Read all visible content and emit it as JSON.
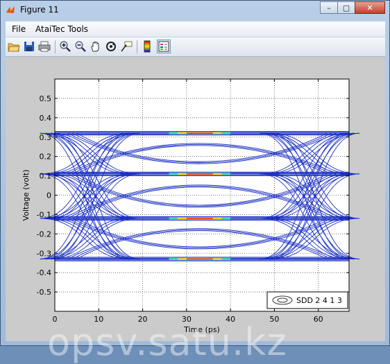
{
  "window": {
    "title": "Figure 11",
    "buttons": [
      "–",
      "▢",
      "✕"
    ]
  },
  "menu": {
    "items": [
      "File",
      "AtaiTec Tools"
    ]
  },
  "toolbar": {
    "icons": [
      "open-folder-icon",
      "save-icon",
      "print-icon",
      "zoom-in-icon",
      "zoom-out-icon",
      "pan-hand-icon",
      "rotate-3d-icon",
      "data-cursor-icon",
      "colorbar-icon",
      "legend-icon"
    ]
  },
  "chart_data": {
    "type": "contour",
    "title": "",
    "xlabel": "Time (ps)",
    "ylabel": "Voltage (volt)",
    "xlim": [
      0,
      67
    ],
    "ylim": [
      -0.6,
      0.6
    ],
    "xticks": [
      0,
      10,
      20,
      30,
      40,
      50,
      60
    ],
    "yticks": [
      -0.5,
      -0.4,
      -0.3,
      -0.2,
      -0.1,
      0,
      0.1,
      0.2,
      0.3,
      0.4,
      0.5
    ],
    "grid": true,
    "legend": {
      "entries": [
        "SDD 2 4 1 3"
      ],
      "placement": "bottom-right"
    },
    "levels": [
      -0.33,
      -0.12,
      0.11,
      0.32
    ],
    "colors": {
      "contour": "#1a2fc4",
      "hot": "#ff3a10",
      "warm": "#ffd21a",
      "mid": "#3dd6c0"
    }
  },
  "watermark": "opsv.satu.kz"
}
